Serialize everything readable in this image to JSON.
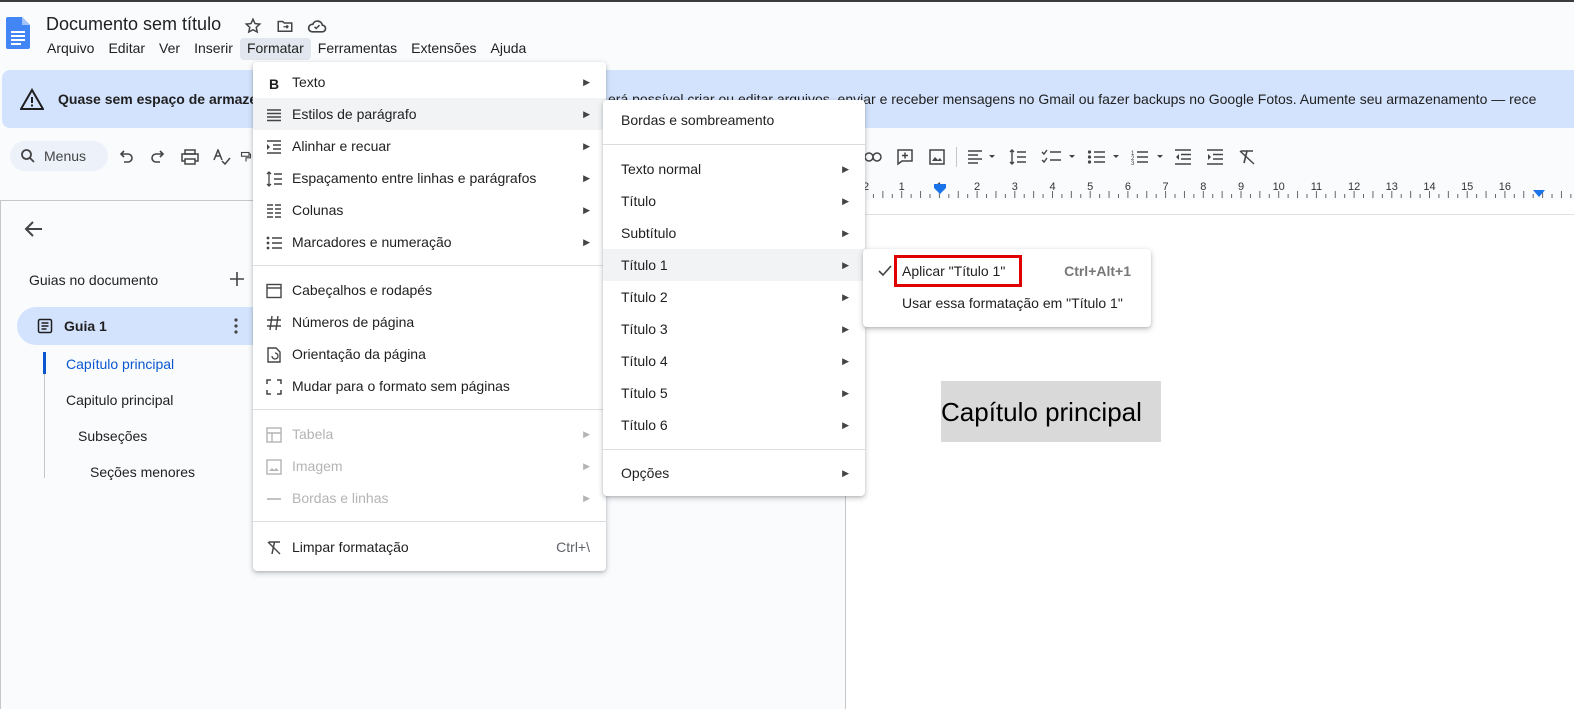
{
  "app": {
    "title": "Documento sem título",
    "menu": [
      "Arquivo",
      "Editar",
      "Ver",
      "Inserir",
      "Formatar",
      "Ferramentas",
      "Extensões",
      "Ajuda"
    ],
    "active_menu": "Formatar"
  },
  "banner": {
    "bold": "Quase sem espaço de armazenamento",
    "rest": "erá possível criar ou editar arquivos, enviar e receber mensagens no Gmail ou fazer backups no Google Fotos. Aumente seu armazenamento — rece"
  },
  "toolbar": {
    "search_label": "Menus"
  },
  "ruler": {
    "ticks": [
      "2",
      "1",
      "1",
      "2",
      "3",
      "4",
      "5",
      "6",
      "7",
      "8",
      "9",
      "10",
      "11",
      "12",
      "13",
      "14",
      "15",
      "16"
    ]
  },
  "sidebar": {
    "heading": "Guias no documento",
    "tab": "Guia 1",
    "outline": [
      {
        "label": "Capítulo principal",
        "active": true
      },
      {
        "label": "Capitulo principal",
        "active": false
      },
      {
        "label": "Subseções",
        "active": false
      },
      {
        "label": "Seções menores",
        "active": false
      }
    ]
  },
  "document": {
    "selected_text": "Capítulo principal"
  },
  "format_menu": {
    "items": [
      {
        "label": "Texto",
        "icon": "bold-icon"
      },
      {
        "label": "Estilos de parágrafo",
        "icon": "paragraph-styles-icon"
      },
      {
        "label": "Alinhar e recuar",
        "icon": "indent-icon"
      },
      {
        "label": "Espaçamento entre linhas e parágrafos",
        "icon": "line-spacing-icon"
      },
      {
        "label": "Colunas",
        "icon": "columns-icon"
      },
      {
        "label": "Marcadores e numeração",
        "icon": "bullets-icon"
      },
      {
        "label": "Cabeçalhos e rodapés",
        "icon": "header-footer-icon"
      },
      {
        "label": "Números de página",
        "icon": "hash-icon"
      },
      {
        "label": "Orientação da página",
        "icon": "orientation-icon"
      },
      {
        "label": "Mudar para o formato sem páginas",
        "icon": "pageless-icon"
      },
      {
        "label": "Tabela",
        "icon": "table-icon"
      },
      {
        "label": "Imagem",
        "icon": "image-icon"
      },
      {
        "label": "Bordas e linhas",
        "icon": "borders-lines-icon"
      },
      {
        "label": "Limpar formatação",
        "icon": "clear-format-icon",
        "shortcut": "Ctrl+\\"
      }
    ]
  },
  "paragraph_styles_menu": {
    "items": [
      "Bordas e sombreamento",
      "Texto normal",
      "Título",
      "Subtítulo",
      "Título 1",
      "Título 2",
      "Título 3",
      "Título 4",
      "Título 5",
      "Título 6",
      "Opções"
    ]
  },
  "heading1_menu": {
    "apply": "Aplicar \"Título 1\"",
    "apply_shortcut": "Ctrl+Alt+1",
    "update": "Usar essa formatação em \"Título 1\""
  },
  "colors": {
    "accent": "#0b57d0",
    "banner": "#d3e3fd",
    "highlight_box": "#e00000"
  }
}
